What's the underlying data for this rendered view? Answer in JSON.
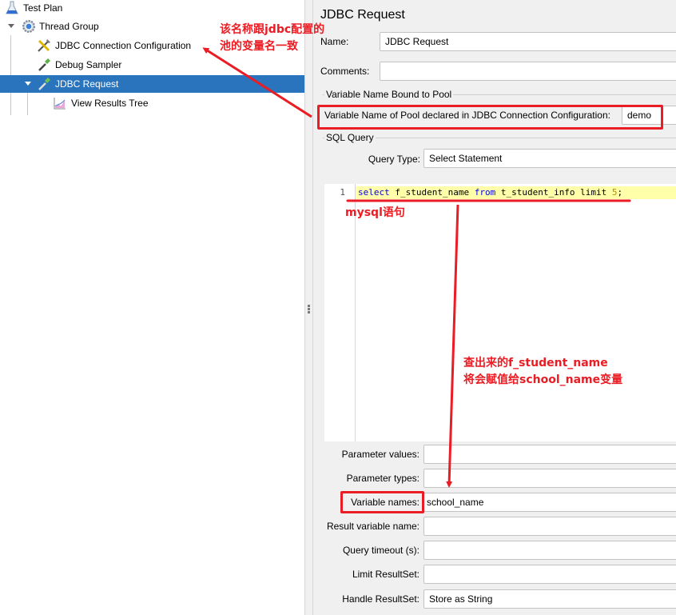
{
  "tree": {
    "items": [
      {
        "label": "Test Plan",
        "icon": "flask-icon",
        "level": 0,
        "expanded": true
      },
      {
        "label": "Thread Group",
        "icon": "gear-icon",
        "level": 1,
        "expanded": true
      },
      {
        "label": "JDBC Connection Configuration",
        "icon": "wrench-screwdriver-icon",
        "level": 2
      },
      {
        "label": "Debug Sampler",
        "icon": "pipette-icon",
        "level": 2
      },
      {
        "label": "JDBC Request",
        "icon": "pipette-icon",
        "level": 2,
        "expanded": true,
        "selected": true
      },
      {
        "label": "View Results Tree",
        "icon": "chart-icon",
        "level": 3
      }
    ]
  },
  "panel": {
    "title": "JDBC Request",
    "name_label": "Name:",
    "name_value": "JDBC Request",
    "comments_label": "Comments:",
    "comments_value": "",
    "pool_group_title": "Variable Name Bound to Pool",
    "pool_label": "Variable Name of Pool declared in JDBC Connection Configuration:",
    "pool_value": "demo",
    "sql_group_title": "SQL Query",
    "query_type_label": "Query Type:",
    "query_type_value": "Select Statement",
    "editor": {
      "line_number": "1",
      "tokens": [
        {
          "text": "select",
          "kind": "keyword"
        },
        {
          "text": " f_student_name ",
          "kind": "plain"
        },
        {
          "text": "from",
          "kind": "keyword"
        },
        {
          "text": " t_student_info limit ",
          "kind": "plain"
        },
        {
          "text": "5",
          "kind": "number"
        },
        {
          "text": ";",
          "kind": "plain"
        }
      ]
    },
    "fields": [
      {
        "label": "Parameter values:",
        "value": ""
      },
      {
        "label": "Parameter types:",
        "value": ""
      },
      {
        "label": "Variable names:",
        "value": "school_name"
      },
      {
        "label": "Result variable name:",
        "value": ""
      },
      {
        "label": "Query timeout (s):",
        "value": ""
      },
      {
        "label": "Limit ResultSet:",
        "value": ""
      },
      {
        "label": "Handle ResultSet:",
        "value": "Store as String"
      }
    ]
  },
  "annotations": {
    "pool_note_line1": "该名称跟jdbc配置的",
    "pool_note_line2": "池的变量名一致",
    "sql_note": "mysql语句",
    "var_note_line1": "查出来的f_student_name",
    "var_note_line2": "将会赋值给school_name变量",
    "color": "#ea1c24"
  },
  "colors": {
    "selection": "#2a74bd",
    "current_line": "#ffffaa",
    "keyword": "#0000e6"
  }
}
